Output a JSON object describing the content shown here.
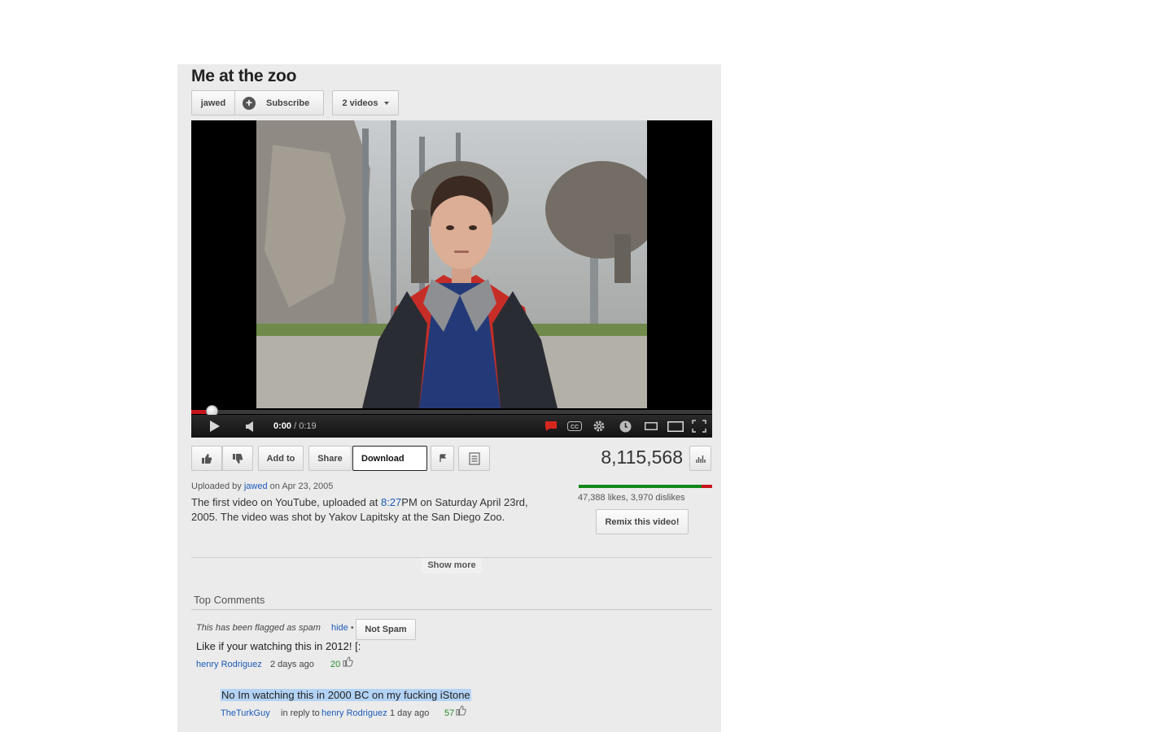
{
  "video": {
    "title": "Me at the zoo",
    "channel_name": "jawed",
    "subscribe_label": "Subscribe",
    "videos_label": "2 videos"
  },
  "player": {
    "current_time": "0:00",
    "time_separator": "/",
    "duration": "0:19",
    "progress_fraction": 0.04
  },
  "actions": {
    "add_to_label": "Add to",
    "share_label": "Share",
    "download_label": "Download"
  },
  "stats": {
    "views": "8,115,568",
    "likes_text": "47,388 likes, 3,970 dislikes",
    "like_ratio": 0.923,
    "remix_label": "Remix this video!"
  },
  "upload": {
    "prefix": "Uploaded by",
    "uploader": "jawed",
    "date_text": "on Apr 23, 2005"
  },
  "description": {
    "part1": "The first video on YouTube, uploaded at ",
    "time_link": "8:27",
    "part2": "PM on Saturday April 23rd, 2005. The video was shot by Yakov Lapitsky at the San Diego Zoo."
  },
  "show_more_label": "Show more",
  "comments": {
    "heading": "Top Comments",
    "spam_note": "This has been flagged as spam",
    "hide_label": "hide",
    "hide_separator": "•",
    "not_spam_label": "Not Spam",
    "items": [
      {
        "text": "Like if your watching this in 2012! [:",
        "author": "henry Rodriguez",
        "time": "2 days ago",
        "votes": "20"
      },
      {
        "text": "No Im watching this in 2000 BC on my fucking iStone",
        "author": "TheTurkGuy",
        "reply_prefix": "in reply to",
        "reply_to": "henry Rodriguez",
        "time": "1 day ago",
        "votes": "57"
      }
    ]
  },
  "colors": {
    "link": "#1b5bb8",
    "progress_red": "#c8161d",
    "like_green": "#13871b",
    "panel_bg": "#ebebeb"
  },
  "icons": [
    "plus-icon",
    "caret-down-icon",
    "play-icon",
    "volume-icon",
    "annotations-icon",
    "cc-icon",
    "gear-icon",
    "watch-later-icon",
    "small-player-icon",
    "large-player-icon",
    "fullscreen-icon",
    "thumbs-up-icon",
    "thumbs-down-icon",
    "flag-icon",
    "transcript-icon",
    "stats-icon"
  ]
}
